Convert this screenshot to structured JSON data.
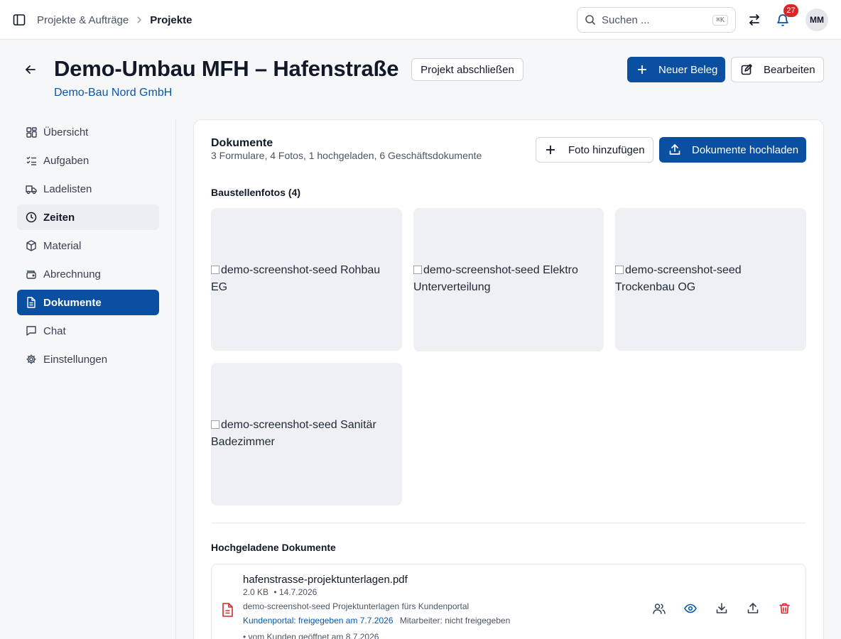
{
  "topbar": {
    "breadcrumb": [
      "Projekte & Aufträge",
      "Projekte"
    ],
    "search_placeholder": "Suchen ...",
    "search_shortcut": "⌘K",
    "notification_count": "27",
    "avatar_initials": "MM"
  },
  "header": {
    "title": "Demo-Umbau MFH – Hafenstraße",
    "client": "Demo-Bau Nord GmbH",
    "close_project_label": "Projekt abschließen",
    "new_document_label": "Neuer Beleg",
    "edit_label": "Bearbeiten"
  },
  "sidebar": {
    "items": [
      {
        "label": "Übersicht",
        "icon": "dashboard-icon"
      },
      {
        "label": "Aufgaben",
        "icon": "tasks-icon"
      },
      {
        "label": "Ladelisten",
        "icon": "truck-icon"
      },
      {
        "label": "Zeiten",
        "icon": "clock-icon",
        "state": "hover"
      },
      {
        "label": "Material",
        "icon": "package-icon"
      },
      {
        "label": "Abrechnung",
        "icon": "wallet-icon"
      },
      {
        "label": "Dokumente",
        "icon": "document-icon",
        "state": "active"
      },
      {
        "label": "Chat",
        "icon": "chat-icon"
      },
      {
        "label": "Einstellungen",
        "icon": "gear-icon"
      }
    ]
  },
  "documents": {
    "title": "Dokumente",
    "summary": "3 Formulare, 4 Fotos, 1 hochgeladen, 6 Geschäftsdokumente",
    "add_photo_label": "Foto hinzufügen",
    "upload_label": "Dokumente hochladen",
    "photos_heading": "Baustellenfotos (4)",
    "photos": [
      {
        "alt": "demo-screenshot-seed Rohbau EG"
      },
      {
        "alt": "demo-screenshot-seed Elektro Unterverteilung"
      },
      {
        "alt": "demo-screenshot-seed Trockenbau OG"
      },
      {
        "alt": "demo-screenshot-seed Sanitär Badezimmer"
      }
    ],
    "uploaded_heading": "Hochgeladene Dokumente",
    "uploaded": [
      {
        "name": "hafenstrasse-projektunterlagen.pdf",
        "size": "2.0 KB",
        "date": "• 14.7.2026",
        "description": "demo-screenshot-seed Projektunterlagen fürs Kundenportal",
        "portal_status": "Kundenportal: freigegeben am 7.7.2026",
        "employee_status": "Mitarbeiter: nicht freigegeben",
        "opened": "• vom Kunden geöffnet am 8.7.2026"
      }
    ]
  },
  "colors": {
    "primary": "#0b4fa0",
    "link": "#0b57a8",
    "danger": "#dc2626"
  }
}
